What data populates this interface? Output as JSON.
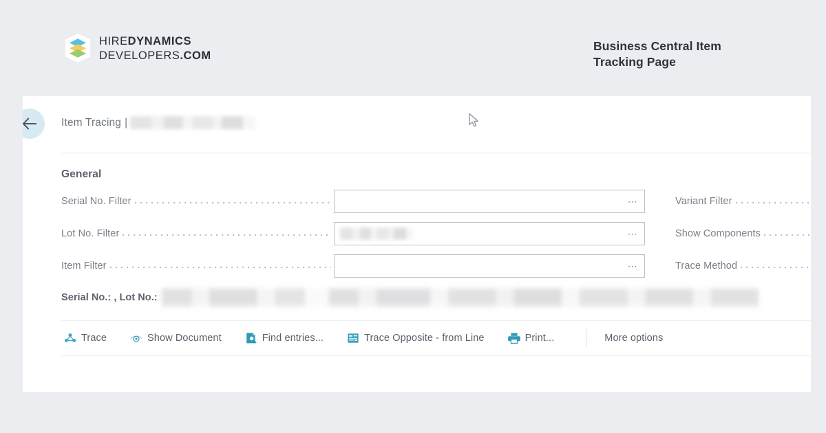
{
  "header": {
    "brand": {
      "logo_icon": "stacked-layers-hexagon-logo",
      "line1_thin": "HIRE",
      "line1_bold": "DYNAMICS",
      "line2_thin": "DEVELOPERS",
      "line2_bold": ".COM"
    },
    "title": "Business Central Item Tracking Page"
  },
  "app": {
    "topbar": {
      "back_icon": "back-arrow-icon",
      "breadcrumb_label": "Item Tracing",
      "breadcrumb_separator": "|",
      "breadcrumb_value": "[redacted]"
    },
    "general": {
      "section_title": "General",
      "fields_left": [
        {
          "label": "Serial No. Filter",
          "value": "",
          "lookup_icon": "ellipsis-lookup-icon",
          "redacted": false
        },
        {
          "label": "Lot No. Filter",
          "value": "[redacted]",
          "lookup_icon": "ellipsis-lookup-icon",
          "redacted": true
        },
        {
          "label": "Item Filter",
          "value": "",
          "lookup_icon": "ellipsis-lookup-icon",
          "redacted": false
        }
      ],
      "fields_right": [
        {
          "label": "Variant Filter"
        },
        {
          "label": "Show Components"
        },
        {
          "label": "Trace Method"
        }
      ],
      "summary": {
        "label": "Serial No.: , Lot No.:",
        "value": "[redacted]"
      }
    },
    "actions": [
      {
        "label": "Trace",
        "icon": "trace-icon"
      },
      {
        "label": "Show Document",
        "icon": "eye-show-document-icon"
      },
      {
        "label": "Find entries...",
        "icon": "find-entries-magnifier-icon"
      },
      {
        "label": "Trace Opposite - from Line",
        "icon": "trace-opposite-grid-icon"
      },
      {
        "label": "Print...",
        "icon": "printer-icon"
      }
    ],
    "more_options_label": "More options"
  },
  "cursor": {
    "icon": "mouse-pointer-cursor"
  },
  "colors": {
    "page_background": "#ebedf0",
    "card_background": "#ffffff",
    "accent_teal": "#2e9bb5",
    "back_circle": "#d7eaf1",
    "label_text": "#7b818a",
    "heading_text": "#2f333a",
    "input_border": "#bcc0c7",
    "divider": "#eceef0",
    "logo_blue": "#58bfe8",
    "logo_yellow": "#f4cd5c",
    "logo_green": "#9ecb6a"
  }
}
